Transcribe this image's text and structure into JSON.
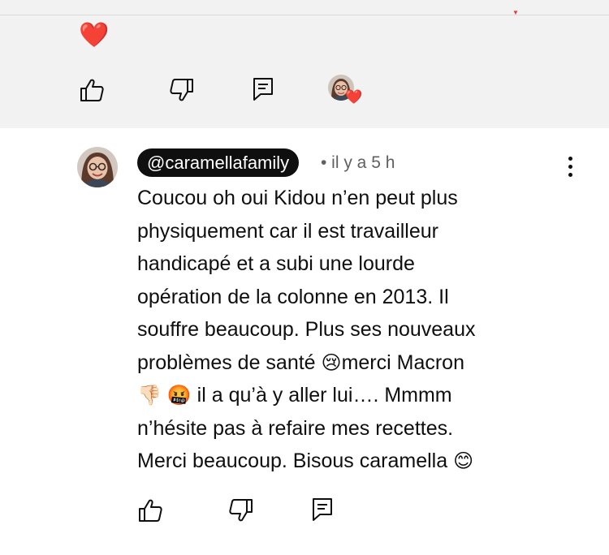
{
  "previous_comment": {
    "heart_emoji": "❤️",
    "actions": {
      "like_icon": "thumbs-up-icon",
      "dislike_icon": "thumbs-down-icon",
      "reply_icon": "reply-icon",
      "creator_heart_badge": "❤️"
    }
  },
  "comment": {
    "author": "@caramellafamily",
    "timestamp": "• il y a 5 h",
    "lines": [
      "Coucou oh oui Kidou n’en peut plus",
      "physiquement car il est travailleur",
      "handicapé et a subi une lourde",
      "opération de la colonne en 2013. Il",
      "souffre beaucoup. Plus ses nouveaux"
    ],
    "line6_text": "problèmes de santé ",
    "line6_emoji": "😢",
    "line6_after": "merci Macron",
    "line7_emoji1": "👎🏻",
    "line7_emoji2": "🤬",
    "line7_text": " il a qu’à y aller lui…. Mmmm",
    "line8": "n’hésite pas à refaire mes recettes.",
    "line9_text": "Merci beaucoup. Bisous caramella ",
    "line9_emoji": "😊"
  },
  "colors": {
    "top_background": "#f2f2f2",
    "author_pill_background": "#0f0f0f",
    "author_pill_text": "#ffffff",
    "timestamp_text": "#606060",
    "heart": "#ff2d2d"
  }
}
